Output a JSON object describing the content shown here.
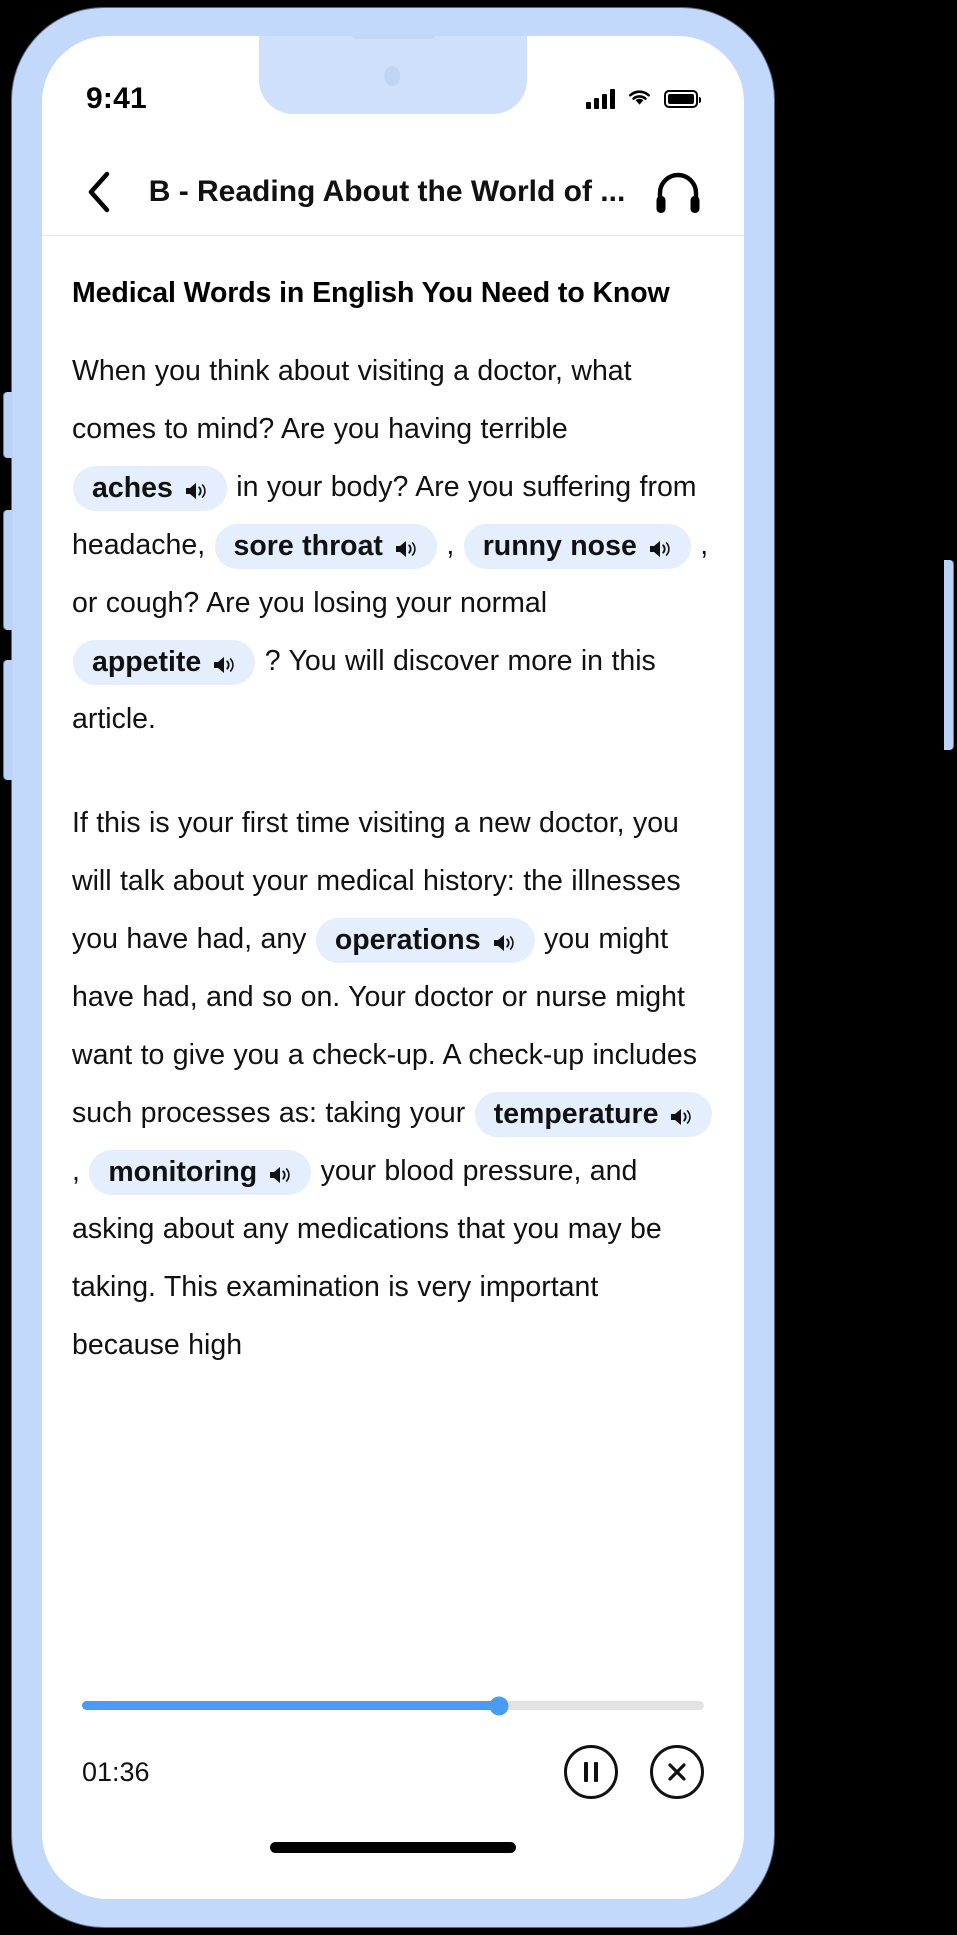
{
  "status_bar": {
    "time": "9:41",
    "cellular_icon": "cellular-signal-icon",
    "wifi_icon": "wifi-icon",
    "battery_icon": "battery-full-icon"
  },
  "nav": {
    "back_icon": "chevron-left-icon",
    "title": "B - Reading About the World of ...",
    "headphones_icon": "headphones-icon"
  },
  "article": {
    "title": "Medical Words in English You Need to Know",
    "paragraphs": [
      {
        "id": "p1",
        "segments": [
          {
            "type": "text",
            "value": "When you think about visiting a doctor, what comes to mind? Are you having terrible "
          },
          {
            "type": "chip",
            "value": "aches"
          },
          {
            "type": "text",
            "value": " in your body? Are you suffering from headache, "
          },
          {
            "type": "chip",
            "value": "sore throat"
          },
          {
            "type": "text",
            "value": " , "
          },
          {
            "type": "chip",
            "value": "runny nose"
          },
          {
            "type": "text",
            "value": " , or cough? Are you losing your normal "
          },
          {
            "type": "chip",
            "value": "appetite"
          },
          {
            "type": "text",
            "value": " ? You will discover more in this article."
          }
        ]
      },
      {
        "id": "p2",
        "segments": [
          {
            "type": "text",
            "value": "If this is your first time visiting a new doctor, you will talk about your medical history: the illnesses you have had, any "
          },
          {
            "type": "chip",
            "value": "operations"
          },
          {
            "type": "text",
            "value": " you might have had, and so on. Your doctor or nurse might want to give you a check-up. A check-up includes such processes as: taking your "
          },
          {
            "type": "chip",
            "value": "temperature"
          },
          {
            "type": "text",
            "value": " , "
          },
          {
            "type": "chip",
            "value": "monitoring"
          },
          {
            "type": "text",
            "value": " your blood pressure, and asking about any medications that you may be taking. This examination is very important because high"
          }
        ]
      }
    ],
    "chip_speaker_icon": "speaker-icon"
  },
  "player": {
    "elapsed_time": "01:36",
    "progress_percent": 67,
    "pause_icon": "pause-icon",
    "close_icon": "close-icon"
  },
  "colors": {
    "frame": "#c3d9fb",
    "chip_background": "#e4eefd",
    "progress_fill": "#4a9bf5",
    "progress_track": "#e3e3e3",
    "screen_background": "#ffffff"
  }
}
